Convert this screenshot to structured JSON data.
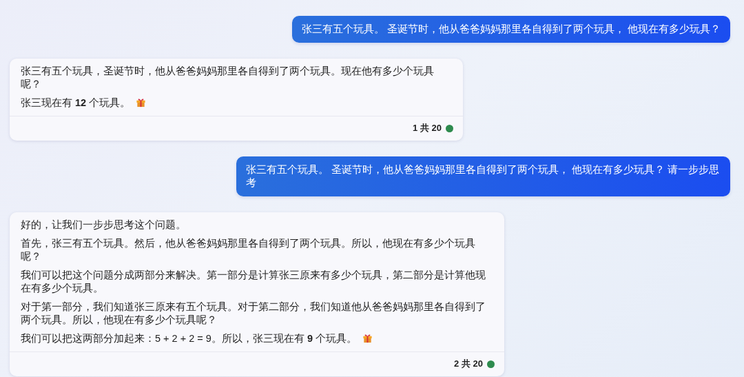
{
  "messages": [
    {
      "kind": "user",
      "lines": [
        "张三有五个玩具。 圣诞节时，他从爸爸妈妈那里各自得到了两个玩具， 他现在有多少玩具？"
      ]
    },
    {
      "kind": "bot",
      "paragraphs": [
        {
          "text": "张三有五个玩具，圣诞节时，他从爸爸妈妈那里各自得到了两个玩具。现在他有多少个玩具呢？",
          "gift": false
        },
        {
          "text": "张三现在有 **12** 个玩具。",
          "gift": true
        }
      ],
      "footer": {
        "count": "1 共 20",
        "color": "#2e8b4e"
      }
    },
    {
      "kind": "user",
      "lines": [
        "张三有五个玩具。 圣诞节时，他从爸爸妈妈那里各自得到了两个玩具， 他现在有多少玩具？ 请一步步思考"
      ]
    },
    {
      "kind": "bot",
      "paragraphs": [
        {
          "text": "好的，让我们一步步思考这个问题。",
          "gift": false
        },
        {
          "text": "首先，张三有五个玩具。然后，他从爸爸妈妈那里各自得到了两个玩具。所以，他现在有多少个玩具呢？",
          "gift": false
        },
        {
          "text": "我们可以把这个问题分成两部分来解决。第一部分是计算张三原来有多少个玩具，第二部分是计算他现在有多少个玩具。",
          "gift": false
        },
        {
          "text": "对于第一部分，我们知道张三原来有五个玩具。对于第二部分，我们知道他从爸爸妈妈那里各自得到了两个玩具。所以，他现在有多少个玩具呢？",
          "gift": false
        },
        {
          "text": "我们可以把这两部分加起来：5 + 2 + 2 = 9。所以，张三现在有 **9** 个玩具。",
          "gift": true
        }
      ],
      "footer": {
        "count": "2 共 20",
        "color": "#2e8b4e"
      }
    }
  ]
}
